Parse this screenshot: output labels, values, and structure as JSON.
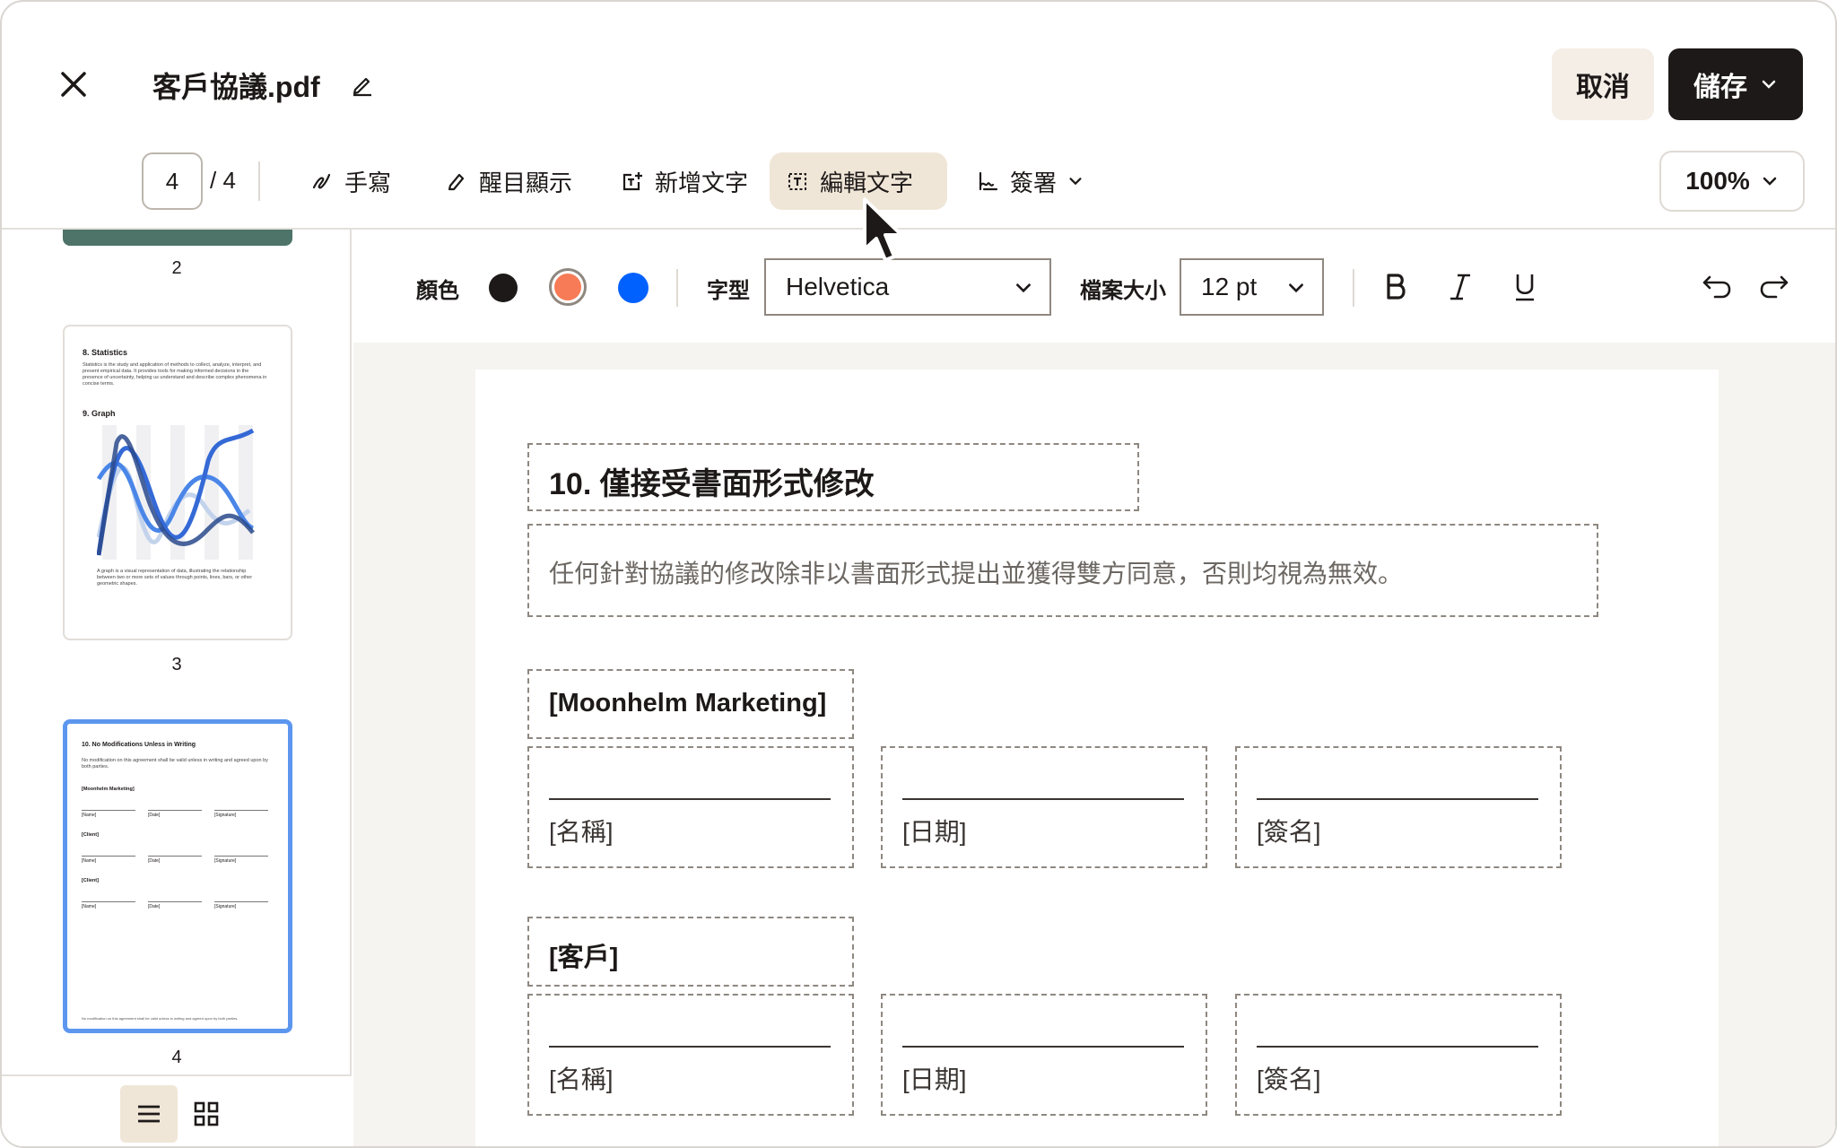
{
  "header": {
    "title": "客戶協議.pdf",
    "cancel_label": "取消",
    "save_label": "儲存"
  },
  "toolbar": {
    "page_current": "4",
    "page_total": "/ 4",
    "tools": [
      {
        "label": "手寫",
        "icon": "pen-squiggle-icon"
      },
      {
        "label": "醒目顯示",
        "icon": "highlighter-icon"
      },
      {
        "label": "新增文字",
        "icon": "add-text-icon"
      },
      {
        "label": "編輯文字",
        "icon": "edit-text-icon",
        "active": true
      },
      {
        "label": "簽署",
        "icon": "signature-icon"
      }
    ],
    "zoom": "100%"
  },
  "format_bar": {
    "color_label": "顏色",
    "colors": [
      "#1e1919",
      "#f77b56",
      "#0061fe"
    ],
    "selected_color": "#f77b56",
    "font_label": "字型",
    "font_value": "Helvetica",
    "size_label": "檔案大小",
    "size_value": "12 pt"
  },
  "sidebar": {
    "thumbnails": [
      {
        "label": "2"
      },
      {
        "label": "3",
        "heading1": "8. Statistics",
        "body1": "Statistics is the study and application of methods to collect, analyze, interpret, and present empirical data. It provides tools for making informed decisions in the presence of uncertainty, helping us understand and describe complex phenomena in concise terms.",
        "heading2": "9. Graph",
        "body2": "A graph is a visual representation of data, illustrating the relationship between two or more sets of values through points, lines, bars, or other geometric shapes."
      },
      {
        "label": "4",
        "selected": true,
        "heading": "10. No Modifications Unless in Writing",
        "body": "No modification on this agreement shall be valid unless in writing and agreed upon by both parties.",
        "party1": "[Moonhelm Marketing]",
        "party2": "[Client]",
        "party3": "[Client]",
        "name": "[Name]",
        "date": "[Date]",
        "signature": "[Signature]",
        "footer": "No modification on this agreement shall be valid unless in writing and agreed upon by both parties."
      }
    ]
  },
  "document": {
    "heading": "10. 僅接受書面形式修改",
    "body": "任何針對協議的修改除非以書面形式提出並獲得雙方同意，否則均視為無效。",
    "party1": "[Moonhelm Marketing]",
    "party2": "[客戶]",
    "name_label": "[名稱]",
    "date_label": "[日期]",
    "signature_label": "[簽名]"
  }
}
